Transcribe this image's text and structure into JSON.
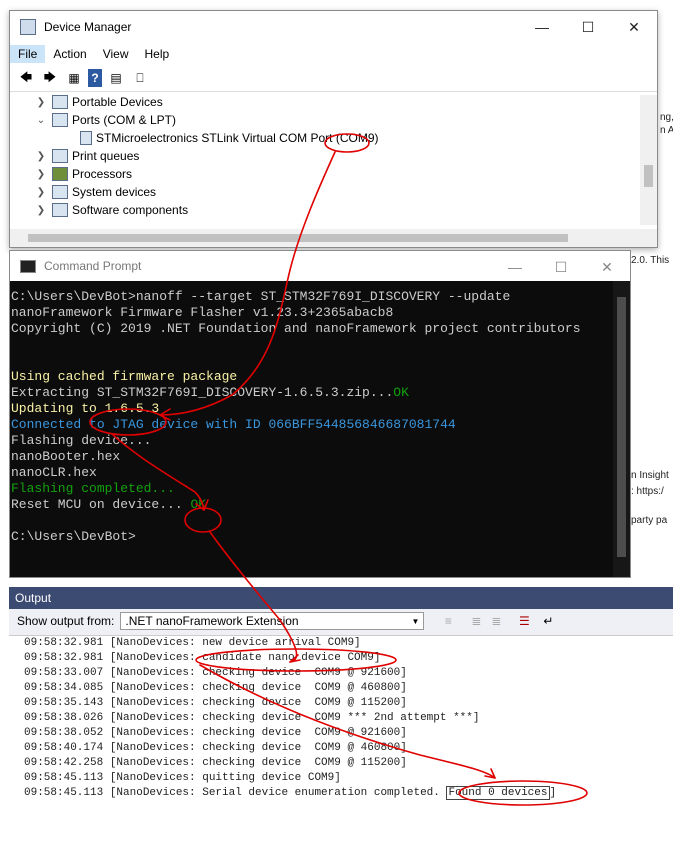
{
  "background": {
    "right_fragments": [
      "ng,",
      "n AP",
      "2.0. This",
      "n Insight",
      ": https:/",
      "party pa"
    ]
  },
  "device_manager": {
    "title": "Device Manager",
    "menu": [
      "File",
      "Action",
      "View",
      "Help"
    ],
    "tree": [
      {
        "label": "Portable Devices",
        "expanded": false
      },
      {
        "label": "Ports (COM & LPT)",
        "expanded": true
      },
      {
        "label": "STMicroelectronics STLink Virtual COM Port (COM9)",
        "child": true
      },
      {
        "label": "Print queues",
        "expanded": false
      },
      {
        "label": "Processors",
        "expanded": false
      },
      {
        "label": "System devices",
        "expanded": false
      },
      {
        "label": "Software components",
        "expanded": false
      }
    ]
  },
  "cmd": {
    "title": "Command Prompt",
    "lines": [
      {
        "text": "C:\\Users\\DevBot>nanoff --target ST_STM32F769I_DISCOVERY --update",
        "color": ""
      },
      {
        "text": "nanoFramework Firmware Flasher v1.23.3+2365abacb8",
        "color": ""
      },
      {
        "text": "Copyright (C) 2019 .NET Foundation and nanoFramework project contributors",
        "color": ""
      },
      {
        "text": "",
        "color": ""
      },
      {
        "text": "",
        "color": ""
      },
      {
        "text": "Using cached firmware package",
        "color": "c-yellow"
      },
      {
        "text": "Extracting ST_STM32F769I_DISCOVERY-1.6.5.3.zip...",
        "color": "",
        "suffix": "OK"
      },
      {
        "text": "Updating to 1.6.5.3",
        "color": "c-yellow"
      },
      {
        "text": "Connected to JTAG device with ID 066BFF544856846687081744",
        "color": "c-cyan"
      },
      {
        "text": "Flashing device...",
        "color": ""
      },
      {
        "text": "nanoBooter.hex",
        "color": ""
      },
      {
        "text": "nanoCLR.hex",
        "color": ""
      },
      {
        "text": "Flashing completed...",
        "color": "c-green"
      },
      {
        "text": "Reset MCU on device... ",
        "color": "",
        "suffix": "OK"
      },
      {
        "text": "",
        "color": ""
      },
      {
        "text": "C:\\Users\\DevBot>",
        "color": ""
      }
    ]
  },
  "output": {
    "title": "Output",
    "show_from_label": "Show output from:",
    "source": ".NET nanoFramework Extension",
    "lines": [
      "09:58:32.981 [NanoDevices: new device arrival COM9]",
      "09:58:32.981 [NanoDevices: candidate nano device COM9]",
      "09:58:33.007 [NanoDevices: checking device  COM9 @ 921600]",
      "09:58:34.085 [NanoDevices: checking device  COM9 @ 460800]",
      "09:58:35.143 [NanoDevices: checking device  COM9 @ 115200]",
      "09:58:38.026 [NanoDevices: checking device  COM9 *** 2nd attempt ***]",
      "09:58:38.052 [NanoDevices: checking device  COM9 @ 921600]",
      "09:58:40.174 [NanoDevices: checking device  COM9 @ 460800]",
      "09:58:42.258 [NanoDevices: checking device  COM9 @ 115200]",
      "09:58:45.113 [NanoDevices: quitting device COM9]"
    ],
    "last_line_prefix": "09:58:45.113 [NanoDevices: Serial device enumeration completed. ",
    "last_line_boxed": "Found 0 devices",
    "last_line_suffix": "]"
  }
}
